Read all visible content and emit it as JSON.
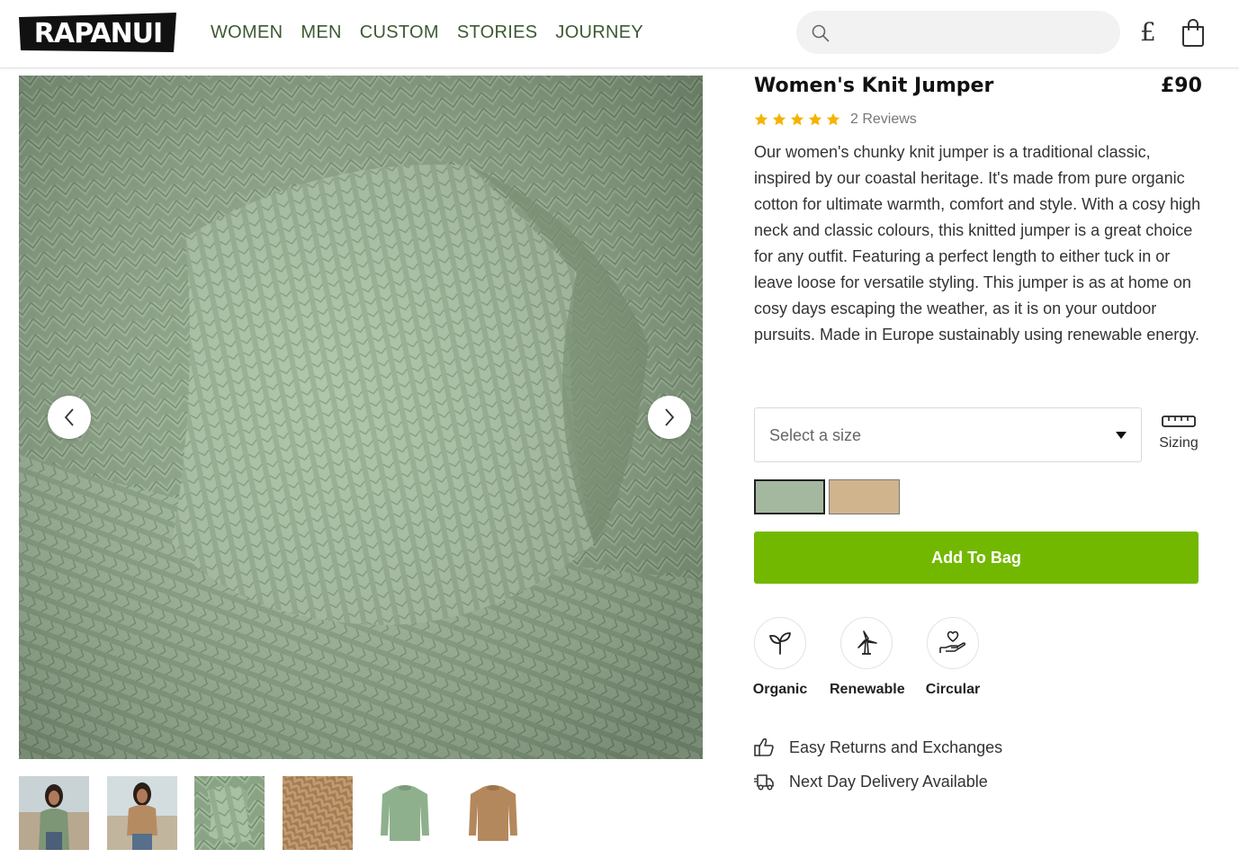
{
  "header": {
    "logo_text": "RAPANUI",
    "nav": [
      "WOMEN",
      "MEN",
      "CUSTOM",
      "STORIES",
      "JOURNEY"
    ],
    "search_placeholder": "",
    "currency_symbol": "£",
    "icons": {
      "search": "search-icon",
      "bag": "shopping-bag-icon"
    }
  },
  "product": {
    "title": "Women's Knit Jumper",
    "price": "£90",
    "rating": 5,
    "reviews_label": "2 Reviews",
    "description": "Our women's chunky knit jumper is a traditional classic, inspired by our coastal heritage. It's made from pure organic cotton for ultimate warmth, comfort and style. With a cosy high neck and classic colours, this knitted jumper is a great choice for any outfit. Featuring a perfect length to either tuck in or leave loose for versatile styling. This jumper is as at home on cosy days escaping the weather, as it is on your outdoor pursuits. Made in Europe sustainably using renewable energy.",
    "size_placeholder": "Select a size",
    "sizing_label": "Sizing",
    "colors": [
      {
        "name": "sage",
        "hex": "#a3b89e",
        "selected": true
      },
      {
        "name": "tan",
        "hex": "#d0b48e",
        "selected": false
      }
    ],
    "add_to_bag_label": "Add To Bag",
    "add_to_bag_color": "#73b800",
    "star_color": "#f5b301",
    "features": [
      {
        "label": "Organic",
        "icon": "sprout-icon"
      },
      {
        "label": "Renewable",
        "icon": "wind-turbine-icon"
      },
      {
        "label": "Circular",
        "icon": "heart-hand-icon"
      }
    ],
    "perks": [
      {
        "label": "Easy Returns and Exchanges",
        "icon": "thumbs-up-icon"
      },
      {
        "label": "Next Day Delivery Available",
        "icon": "delivery-truck-icon"
      }
    ]
  },
  "gallery": {
    "thumbnails": [
      "model-sage-jumper",
      "model-tan-jumper",
      "sage-knit-detail",
      "tan-knit-detail",
      "sage-jumper-flat",
      "tan-jumper-flat"
    ]
  }
}
